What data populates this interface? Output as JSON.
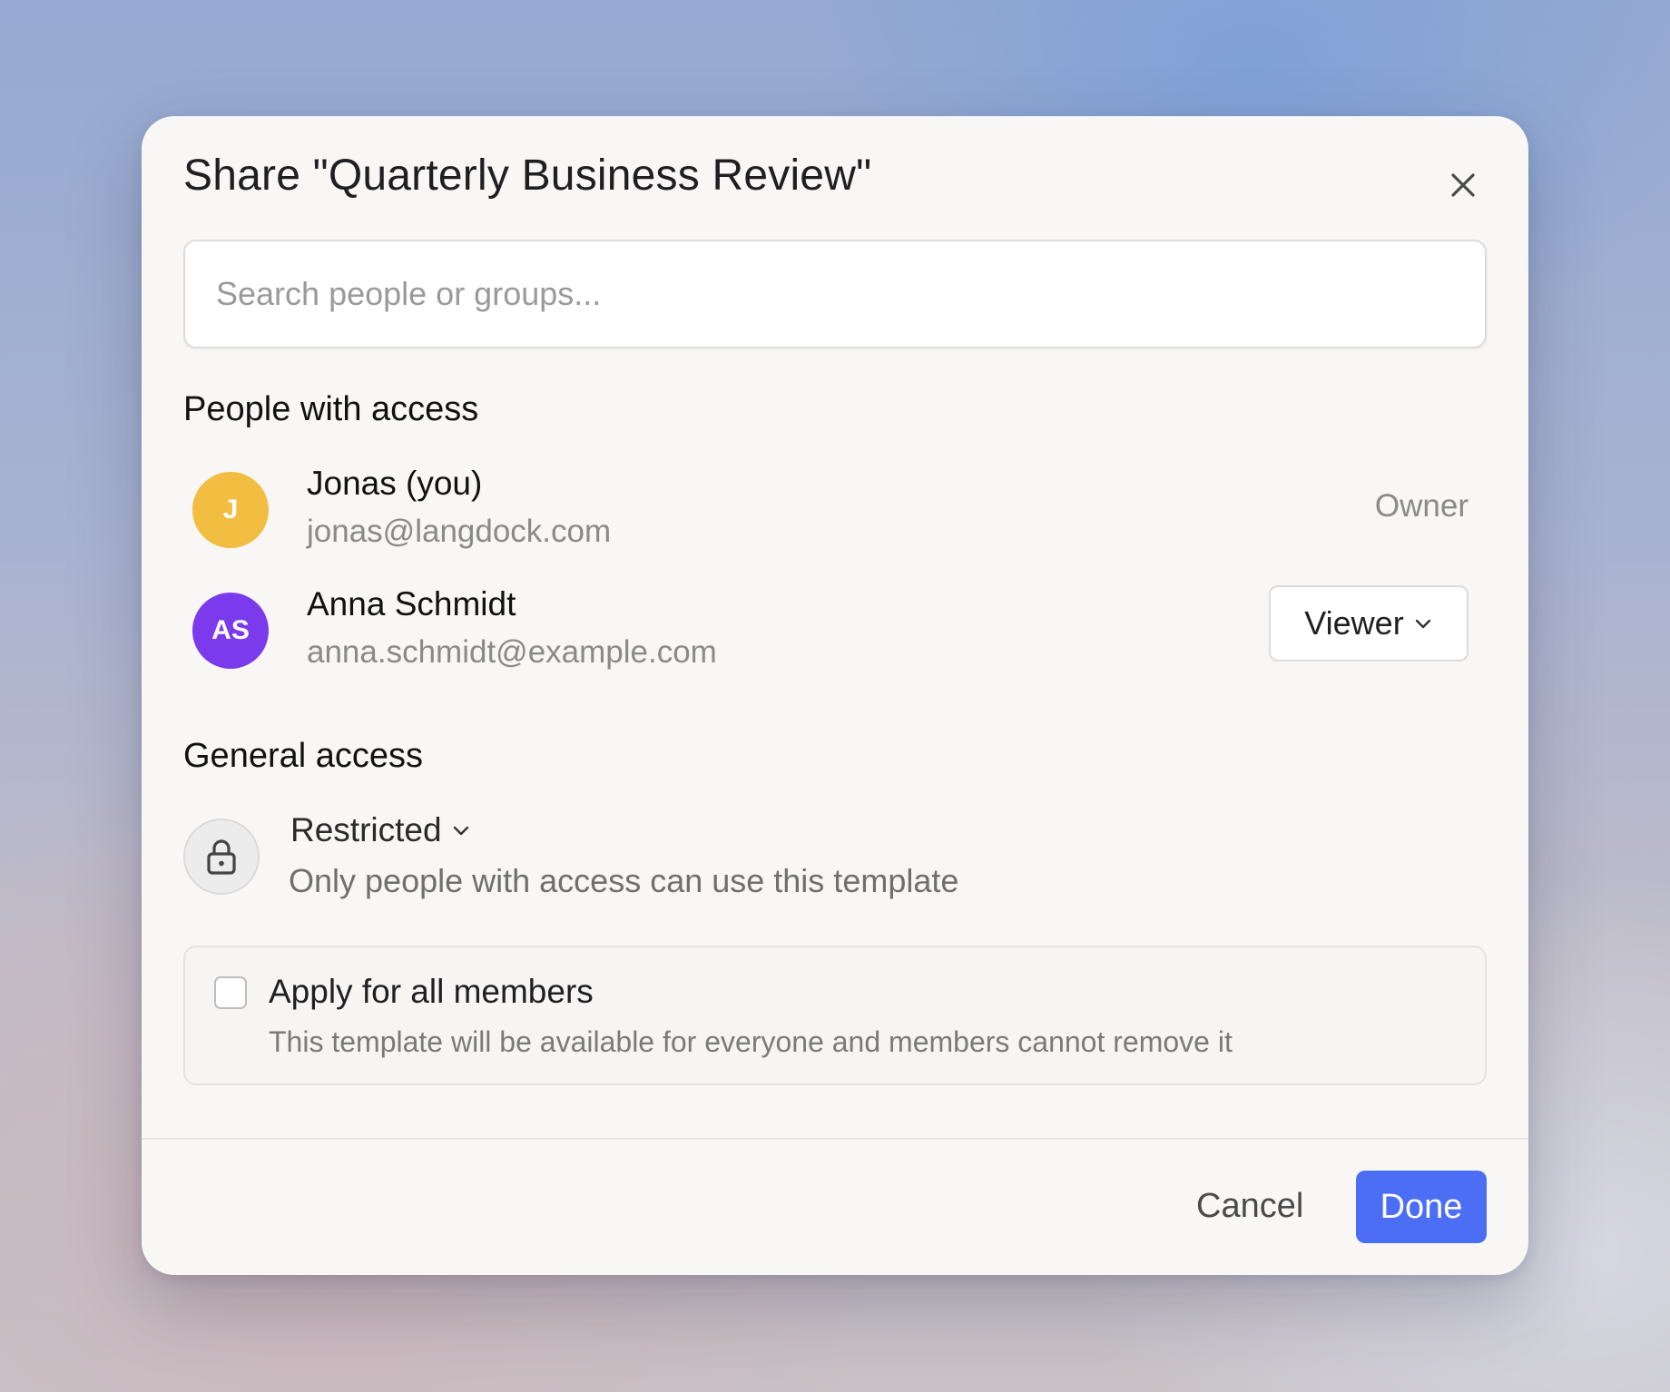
{
  "dialog": {
    "title": "Share \"Quarterly Business Review\"",
    "close_icon": "close-icon"
  },
  "search": {
    "placeholder": "Search people or groups...",
    "value": ""
  },
  "people_section": {
    "title": "People with access",
    "people": [
      {
        "initials": "J",
        "avatar_color": "#F2BE42",
        "name": "Jonas (you)",
        "email": "jonas@langdock.com",
        "role": "Owner"
      },
      {
        "initials": "AS",
        "avatar_color": "#7C3AED",
        "name": "Anna Schmidt",
        "email": "anna.schmidt@example.com",
        "role": "Viewer",
        "role_icon": "chevron-down-icon"
      }
    ]
  },
  "general_access": {
    "title": "General access",
    "icon": "lock-icon",
    "level": "Restricted",
    "level_icon": "chevron-down-icon",
    "description": "Only people with access can use this template"
  },
  "apply_all": {
    "checked": false,
    "label": "Apply for all members",
    "description": "This template will be available for everyone and members cannot remove it"
  },
  "footer": {
    "cancel_label": "Cancel",
    "done_label": "Done",
    "done_color": "#4B6EF5"
  }
}
